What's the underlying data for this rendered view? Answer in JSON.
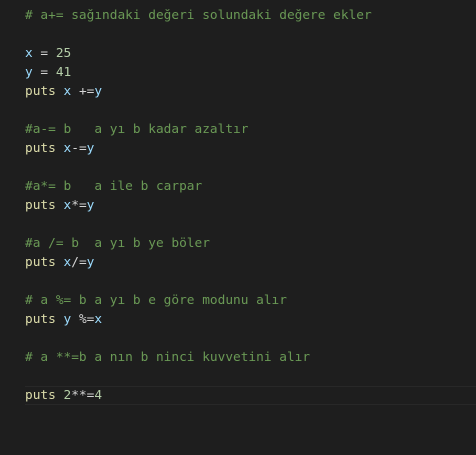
{
  "editor": {
    "current_line": 20,
    "lines": [
      [
        {
          "t": "comment",
          "v": "# a+= sağındaki değeri solundaki değere ekler"
        }
      ],
      [],
      [
        {
          "t": "var",
          "v": "x"
        },
        {
          "t": "op",
          "v": " = "
        },
        {
          "t": "num",
          "v": "25"
        }
      ],
      [
        {
          "t": "var",
          "v": "y"
        },
        {
          "t": "op",
          "v": " = "
        },
        {
          "t": "num",
          "v": "41"
        }
      ],
      [
        {
          "t": "fn",
          "v": "puts "
        },
        {
          "t": "var",
          "v": "x"
        },
        {
          "t": "op",
          "v": " +="
        },
        {
          "t": "var",
          "v": "y"
        }
      ],
      [],
      [
        {
          "t": "comment",
          "v": "#a-= b   a yı b kadar azaltır"
        }
      ],
      [
        {
          "t": "fn",
          "v": "puts "
        },
        {
          "t": "var",
          "v": "x"
        },
        {
          "t": "op",
          "v": "-="
        },
        {
          "t": "var",
          "v": "y"
        }
      ],
      [],
      [
        {
          "t": "comment",
          "v": "#a*= b   a ile b carpar"
        }
      ],
      [
        {
          "t": "fn",
          "v": "puts "
        },
        {
          "t": "var",
          "v": "x"
        },
        {
          "t": "op",
          "v": "*="
        },
        {
          "t": "var",
          "v": "y"
        }
      ],
      [],
      [
        {
          "t": "comment",
          "v": "#a /= b  a yı b ye böler"
        }
      ],
      [
        {
          "t": "fn",
          "v": "puts "
        },
        {
          "t": "var",
          "v": "x"
        },
        {
          "t": "op",
          "v": "/="
        },
        {
          "t": "var",
          "v": "y"
        }
      ],
      [],
      [
        {
          "t": "comment",
          "v": "# a %= b a yı b e göre modunu alır"
        }
      ],
      [
        {
          "t": "fn",
          "v": "puts "
        },
        {
          "t": "var",
          "v": "y"
        },
        {
          "t": "op",
          "v": " %="
        },
        {
          "t": "var",
          "v": "x"
        }
      ],
      [],
      [
        {
          "t": "comment",
          "v": "# a **=b a nın b ninci kuvvetini alır"
        }
      ],
      [],
      [
        {
          "t": "fn",
          "v": "puts "
        },
        {
          "t": "num",
          "v": "2"
        },
        {
          "t": "op",
          "v": "**="
        },
        {
          "t": "num",
          "v": "4"
        }
      ]
    ]
  },
  "colors": {
    "background": "#1e1e1e",
    "comment": "#6a9955",
    "function": "#dcdcaa",
    "variable": "#9cdcfe",
    "number": "#b5cea8",
    "operator": "#d4d4d4"
  }
}
